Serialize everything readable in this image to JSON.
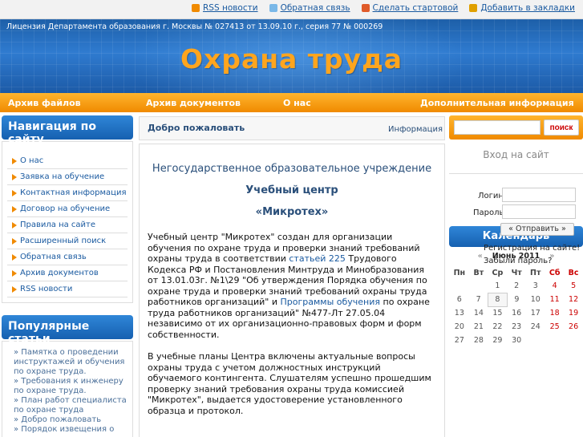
{
  "top_links": [
    {
      "label": "RSS новости",
      "icon": "rss-icon",
      "color": "#f08a00"
    },
    {
      "label": "Обратная связь",
      "icon": "mail-icon",
      "color": "#7ab8e8"
    },
    {
      "label": "Сделать стартовой",
      "icon": "home-icon",
      "color": "#e05b2a"
    },
    {
      "label": "Добавить в закладки",
      "icon": "bookmark-icon",
      "color": "#e0a000"
    }
  ],
  "header": {
    "license": "Лицензия  Департамента образования г. Москвы № 027413 от 13.09.10 г., серия 77 № 000269",
    "title": "Охрана труда"
  },
  "nav": [
    "Архив файлов",
    "Архив документов",
    "О нас",
    "Дополнительная информация"
  ],
  "left": {
    "navigation_title": "Навигация по сайту",
    "items": [
      "О нас",
      "Заявка на обучение",
      "Контактная информация",
      "Договор на обучение",
      "Правила на сайте",
      "Расширенный поиск",
      "Обратная связь",
      "Архив документов",
      "RSS новости"
    ],
    "popular_title": "Популярные статьи",
    "popular": [
      "» Памятка о проведении инструктажей и обучения по охране труда.",
      "» Требования к инженеру по охране труда.",
      "» План работ специалиста по охране труда",
      "» Добро пожаловать",
      "» Порядок извещения о"
    ]
  },
  "center": {
    "tab_title": "Добро пожаловать",
    "tab_right": "Информация",
    "heading1": "Негосударственное образовательное учреждение",
    "heading2": "Учебный центр",
    "heading3": "«Микротех»",
    "para1_a": "  Учебный центр  \"Микротех\"  создан для организации обучения по охране труда и проверки знаний требований охраны труда в соответствии         ",
    "para1_link1": "статьей   225",
    "para1_b": " Трудового Кодекса РФ и Постановления Минтруда и Минобразования от 13.01.03г.  №1\\29 \"Об утверждения Порядка обучения по охране труда и проверки знаний требований охраны труда работников организаций\" и   ",
    "para1_link2": "Программы обучения",
    "para1_c": "  по охране труда работников организаций\"  №477-Лт    27.05.04 независимо от их организационно-правовых форм и форм собственности.",
    "para2": "В учебные планы Центра включены актуальные вопросы охраны труда с учетом должностных инструкций обучаемого контингента. Слушателям  успешно прошедшим проверку знаний требования охраны труда комиссией \"Микротех\", выдается удостоверение установленного образца и протокол."
  },
  "right": {
    "search_placeholder": "",
    "search_button": "поиск",
    "login_title": "Вход на сайт",
    "login_label": "Логин",
    "password_label": "Пароль",
    "submit": "« Отправить »",
    "register": "Регистрация на сайте!",
    "forgot": "Забыли пароль?",
    "calendar_title": "Календарь",
    "month": "Июнь 2011",
    "prev": "«",
    "next": "»",
    "weekdays": [
      "Пн",
      "Вт",
      "Ср",
      "Чт",
      "Пт",
      "Сб",
      "Вс"
    ],
    "weeks": [
      [
        "",
        "",
        "1",
        "2",
        "3",
        "4",
        "5"
      ],
      [
        "6",
        "7",
        "8",
        "9",
        "10",
        "11",
        "12"
      ],
      [
        "13",
        "14",
        "15",
        "16",
        "17",
        "18",
        "19"
      ],
      [
        "20",
        "21",
        "22",
        "23",
        "24",
        "25",
        "26"
      ],
      [
        "27",
        "28",
        "29",
        "30",
        "",
        "",
        ""
      ]
    ],
    "today": "8"
  }
}
